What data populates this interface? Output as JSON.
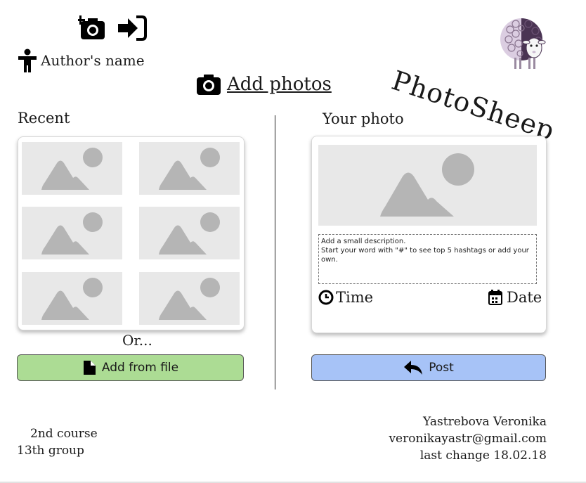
{
  "header": {
    "author_name": "Author's name",
    "add_photos_label": "Add photos",
    "brand": "PhotoSheep"
  },
  "icons": {
    "add_photo": "camera-plus-icon",
    "sign_in": "sign-in-icon",
    "user": "user-icon",
    "camera": "camera-icon",
    "file": "file-icon",
    "reply": "reply-icon",
    "clock": "clock-icon",
    "calendar": "calendar-icon",
    "logo": "sheep-logo-icon"
  },
  "recent": {
    "title": "Recent",
    "or_label": "Or...",
    "add_file_label": "Add from file"
  },
  "your_photo": {
    "title": "Your photo",
    "description_placeholder": "Add a small description.\nStart your word with \"#\" to see top 5 hashtags or add your own.",
    "time_label": "Time",
    "date_label": "Date",
    "post_label": "Post"
  },
  "footer": {
    "course": "2nd course",
    "group": "13th group",
    "author": "Yastrebova Veronika",
    "email": "veronikayastr@gmail.com",
    "last_change": "last change 18.02.18"
  },
  "colors": {
    "add_file_button": "#acdc94",
    "post_button": "#a7c3f7",
    "placeholder_bg": "#e8e8e8",
    "placeholder_shape": "#b5b5b5",
    "sheep_wool": "#dbcde1",
    "sheep_dark": "#4a3453"
  }
}
